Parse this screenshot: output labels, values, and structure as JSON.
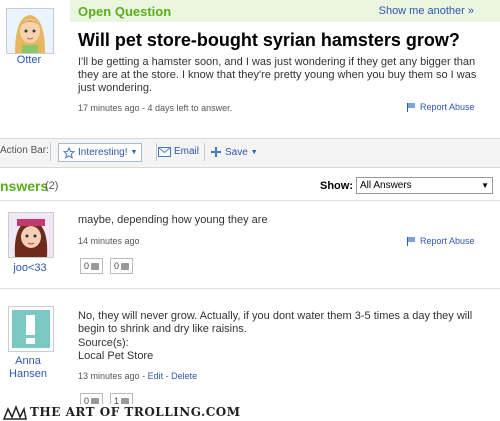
{
  "question": {
    "kind_label": "Open Question",
    "show_another": "Show me another »",
    "asker_name": "Otter",
    "title": "Will pet store-bought syrian hamsters grow?",
    "body": "I'll be getting a hamster soon, and I was just wondering if they get any bigger than they are at the store. I know that they're pretty young when you buy them so I was just wondering.",
    "meta": "17 minutes ago - 4 days left to answer.",
    "report_label": "Report Abuse"
  },
  "action_bar": {
    "label": "Action Bar:",
    "interesting": "Interesting!",
    "email": "Email",
    "save": "Save"
  },
  "answers": {
    "title": "nswers",
    "count": "(2)",
    "show_label": "Show:",
    "filter_value": "All Answers",
    "items": [
      {
        "name": "joo<33",
        "text": "maybe, depending how young they are",
        "meta": "14 minutes ago",
        "report_label": "Report Abuse",
        "up": "0",
        "down": "0"
      },
      {
        "name_line1": "Anna",
        "name_line2": "Hansen",
        "text": "No, they will never grow. Actually, if you dont water them 3-5 times a day they will begin to shrink and dry like raisins.",
        "sources_label": "Source(s):",
        "source": "Local Pet Store",
        "meta_time": "13 minutes ago",
        "edit": "Edit",
        "delete": "Delete",
        "up": "0",
        "down": "1"
      }
    ]
  },
  "watermark": "THE ART OF TROLLING.COM",
  "colors": {
    "accent_green": "#5cad1b",
    "link_blue": "#2d57b0",
    "header_bg": "#eaf6df"
  }
}
